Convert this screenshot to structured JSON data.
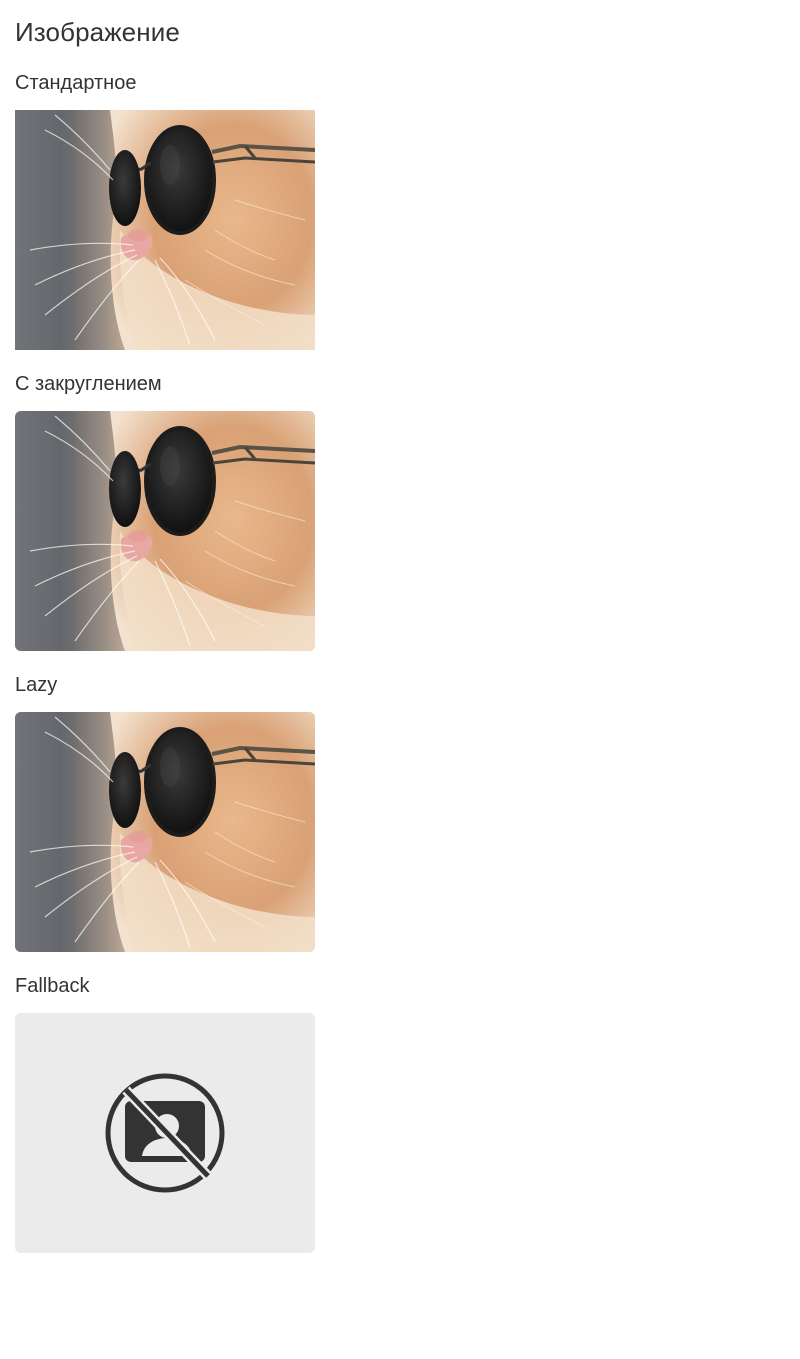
{
  "page": {
    "title": "Изображение"
  },
  "sections": [
    {
      "title": "Стандартное",
      "image": "cat-with-sunglasses-photo",
      "rounded": false
    },
    {
      "title": "С закруглением",
      "image": "cat-with-sunglasses-photo",
      "rounded": true
    },
    {
      "title": "Lazy",
      "image": "cat-with-sunglasses-photo",
      "rounded": true
    },
    {
      "title": "Fallback",
      "image": "no-image-icon",
      "rounded": true
    }
  ],
  "colors": {
    "text": "#333333",
    "fallback_bg": "#ebebeb",
    "fallback_icon": "#333333"
  }
}
